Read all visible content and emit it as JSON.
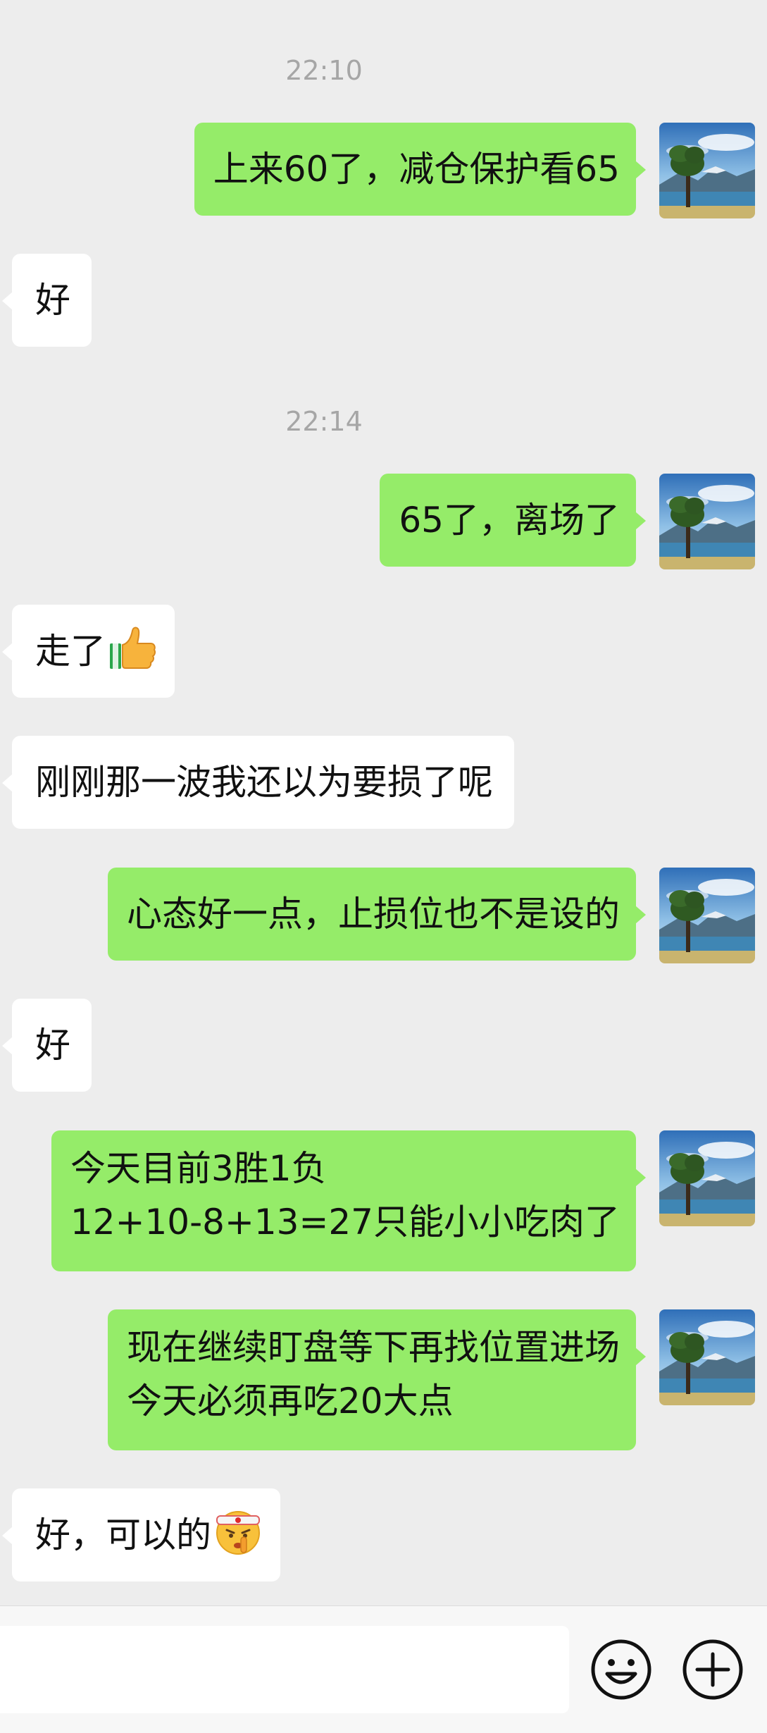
{
  "messages": [
    {
      "type": "time",
      "text": "22:10"
    },
    {
      "type": "out",
      "text": "上来60了，减仓保护看65"
    },
    {
      "type": "in",
      "text": "好"
    },
    {
      "type": "time",
      "text": "22:14"
    },
    {
      "type": "out",
      "text": "65了，离场了"
    },
    {
      "type": "in",
      "text": "走了",
      "emoji": "thumbs-up"
    },
    {
      "type": "in",
      "text": "刚刚那一波我还以为要损了呢"
    },
    {
      "type": "out",
      "text": "心态好一点，止损位也不是设的"
    },
    {
      "type": "in",
      "text": "好"
    },
    {
      "type": "out",
      "lines": [
        "今天目前3胜1负",
        "12+10-8+13=27只能小小吃肉了"
      ]
    },
    {
      "type": "out",
      "lines": [
        "现在继续盯盘等下再找位置进场",
        "今天必须再吃20大点"
      ]
    },
    {
      "type": "in",
      "text": "好，可以的",
      "emoji": "shushing-face-with-headband"
    }
  ],
  "input_bar": {
    "text": "",
    "emoji_icon": "smiley-icon",
    "more_icon": "plus-circle-icon"
  },
  "colors": {
    "background": "#ededed",
    "outgoing_bubble": "#95ec69",
    "incoming_bubble": "#ffffff",
    "timestamp": "#a6a6a6"
  }
}
